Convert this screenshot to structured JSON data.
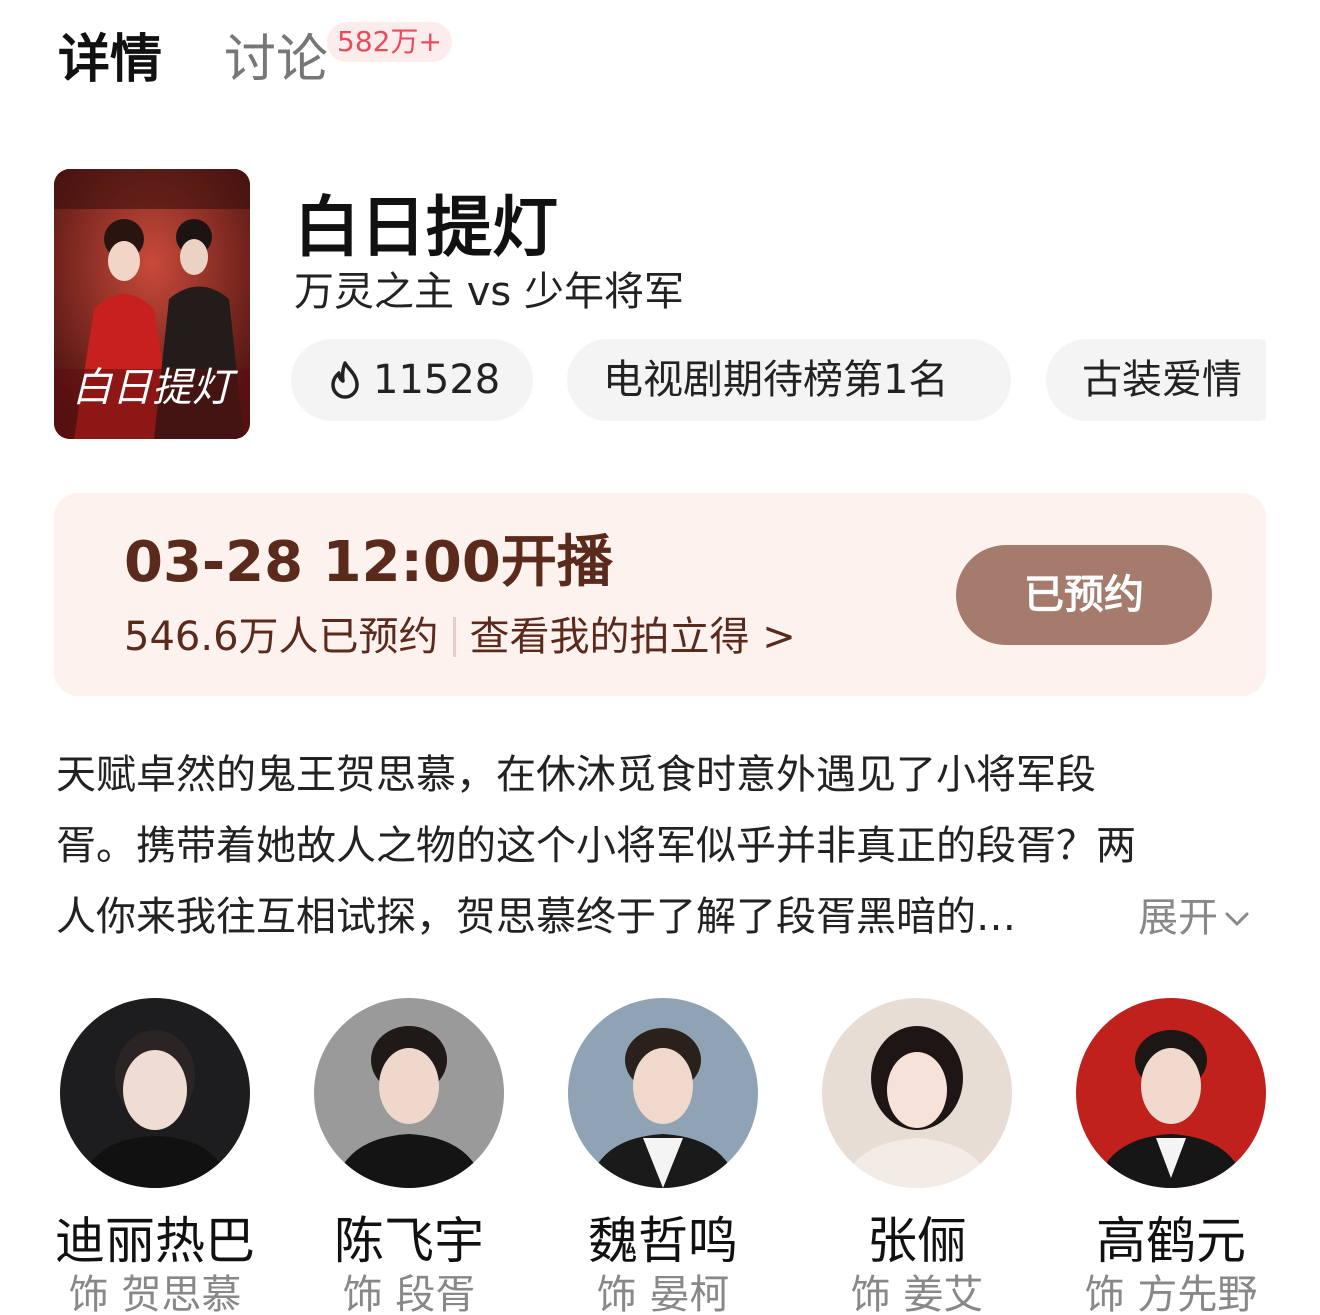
{
  "tabs": [
    {
      "label": "详情",
      "active": true
    },
    {
      "label": "讨论",
      "active": false,
      "badge": "582万+"
    }
  ],
  "show": {
    "title": "白日提灯",
    "subtitle": "万灵之主 vs 少年将军",
    "poster_text": "白日提灯",
    "chips": {
      "heat": "11528",
      "rank": "电视剧期待榜第1名",
      "genre": "古装爱情"
    }
  },
  "schedule": {
    "air_time": "03-28 12:00开播",
    "reserved_count": "546.6万人已预约",
    "polaroid_link": "查看我的拍立得 >",
    "button_label": "已预约"
  },
  "synopsis": {
    "lines": [
      "天赋卓然的鬼王贺思慕，在休沐觅食时意外遇见了小将军段",
      "胥。携带着她故人之物的这个小将军似乎并非真正的段胥？两",
      "人你来我往互相试探，贺思慕终于了解了段胥黑暗的…"
    ],
    "expand_label": "展开"
  },
  "cast": [
    {
      "name": "迪丽热巴",
      "role": "饰 贺思慕"
    },
    {
      "name": "陈飞宇",
      "role": "饰 段胥"
    },
    {
      "name": "魏哲鸣",
      "role": "饰 晏柯"
    },
    {
      "name": "张俪",
      "role": "饰 姜艾"
    },
    {
      "name": "高鹤元",
      "role": "饰 方先野"
    }
  ],
  "colors": {
    "accent_badge": "#ec4a5a",
    "card_bg": "#fdf2ee",
    "card_text": "#5a2a1c",
    "button_bg": "#a47b6c"
  }
}
